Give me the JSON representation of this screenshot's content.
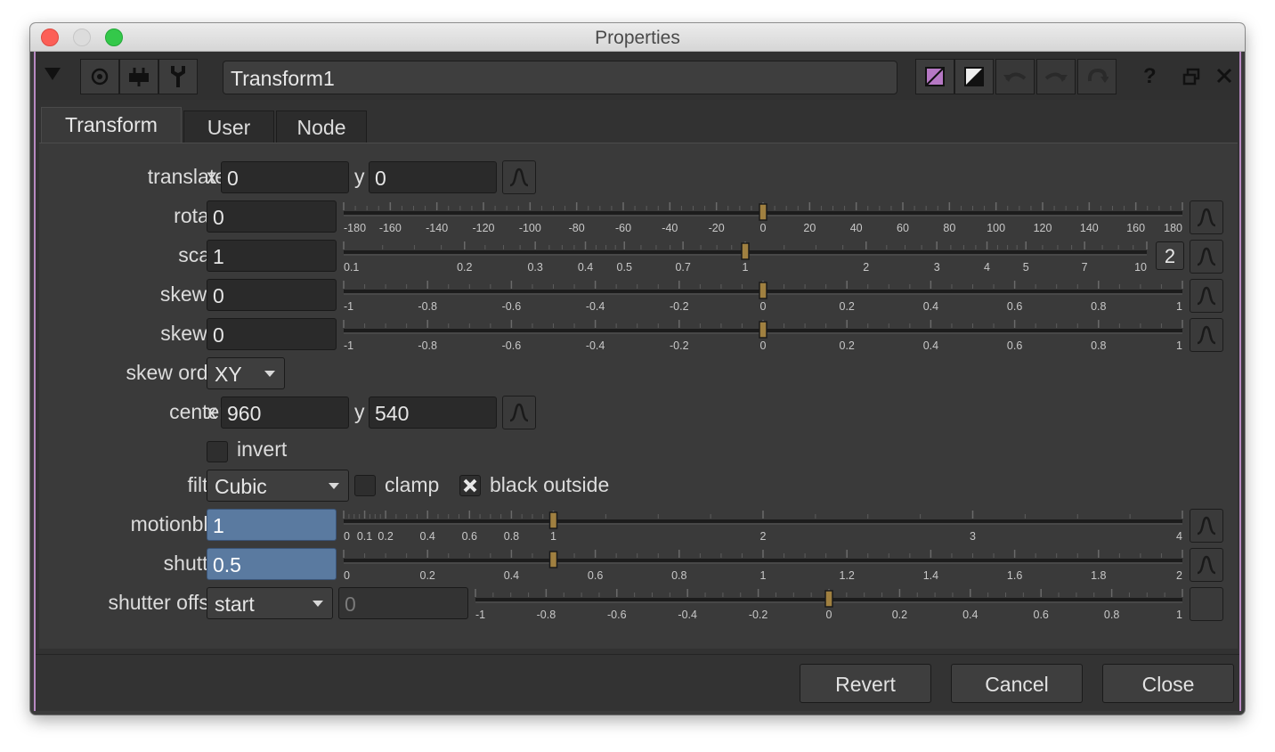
{
  "window": {
    "title": "Properties"
  },
  "node": {
    "name": "Transform1"
  },
  "toolbar": {
    "help": "?"
  },
  "tabs": [
    {
      "label": "Transform"
    },
    {
      "label": "User"
    },
    {
      "label": "Node"
    }
  ],
  "params": {
    "translate": {
      "label": "translate",
      "x_axis": "x",
      "y_axis": "y",
      "x": "0",
      "y": "0"
    },
    "rotate": {
      "label": "rotate",
      "value": "0",
      "ticks": [
        "-180",
        "-160",
        "-140",
        "-120",
        "-100",
        "-80",
        "-60",
        "-40",
        "-20",
        "0",
        "20",
        "40",
        "60",
        "80",
        "100",
        "120",
        "140",
        "160",
        "180"
      ]
    },
    "scale": {
      "label": "scale",
      "value": "1",
      "channels": "2",
      "ticks": [
        "0.1",
        "0.2",
        "0.3",
        "0.4",
        "0.5",
        "0.7",
        "1",
        "2",
        "3",
        "4",
        "5",
        "7",
        "10"
      ]
    },
    "skew_x": {
      "label": "skew X",
      "value": "0",
      "ticks": [
        "-1",
        "-0.8",
        "-0.6",
        "-0.4",
        "-0.2",
        "0",
        "0.2",
        "0.4",
        "0.6",
        "0.8",
        "1"
      ]
    },
    "skew_y": {
      "label": "skew Y",
      "value": "0",
      "ticks": [
        "-1",
        "-0.8",
        "-0.6",
        "-0.4",
        "-0.2",
        "0",
        "0.2",
        "0.4",
        "0.6",
        "0.8",
        "1"
      ]
    },
    "skew_order": {
      "label": "skew order",
      "value": "XY"
    },
    "center": {
      "label": "center",
      "x_axis": "x",
      "y_axis": "y",
      "x": "960",
      "y": "540"
    },
    "invert": {
      "label": "invert",
      "checked": false
    },
    "filter": {
      "label": "filter",
      "value": "Cubic"
    },
    "clamp": {
      "label": "clamp",
      "checked": false
    },
    "black_outside": {
      "label": "black outside",
      "checked": true
    },
    "motionblur": {
      "label": "motionblur",
      "value": "1",
      "ticks": [
        "0",
        "0.1",
        "0.2",
        "0.4",
        "0.6",
        "0.8",
        "1",
        "2",
        "3",
        "4"
      ]
    },
    "shutter": {
      "label": "shutter",
      "value": "0.5",
      "ticks": [
        "0",
        "0.2",
        "0.4",
        "0.6",
        "0.8",
        "1",
        "1.2",
        "1.4",
        "1.6",
        "1.8",
        "2"
      ]
    },
    "shutter_offset": {
      "label": "shutter offset",
      "mode": "start",
      "value": "0",
      "ticks": [
        "-1",
        "-0.8",
        "-0.6",
        "-0.4",
        "-0.2",
        "0",
        "0.2",
        "0.4",
        "0.6",
        "0.8",
        "1"
      ]
    }
  },
  "footer": {
    "revert": "Revert",
    "cancel": "Cancel",
    "close": "Close"
  },
  "colors": {
    "accent_border": "#b889c2",
    "field_highlight": "#5a7aa0",
    "slider_handle": "#a08040"
  }
}
